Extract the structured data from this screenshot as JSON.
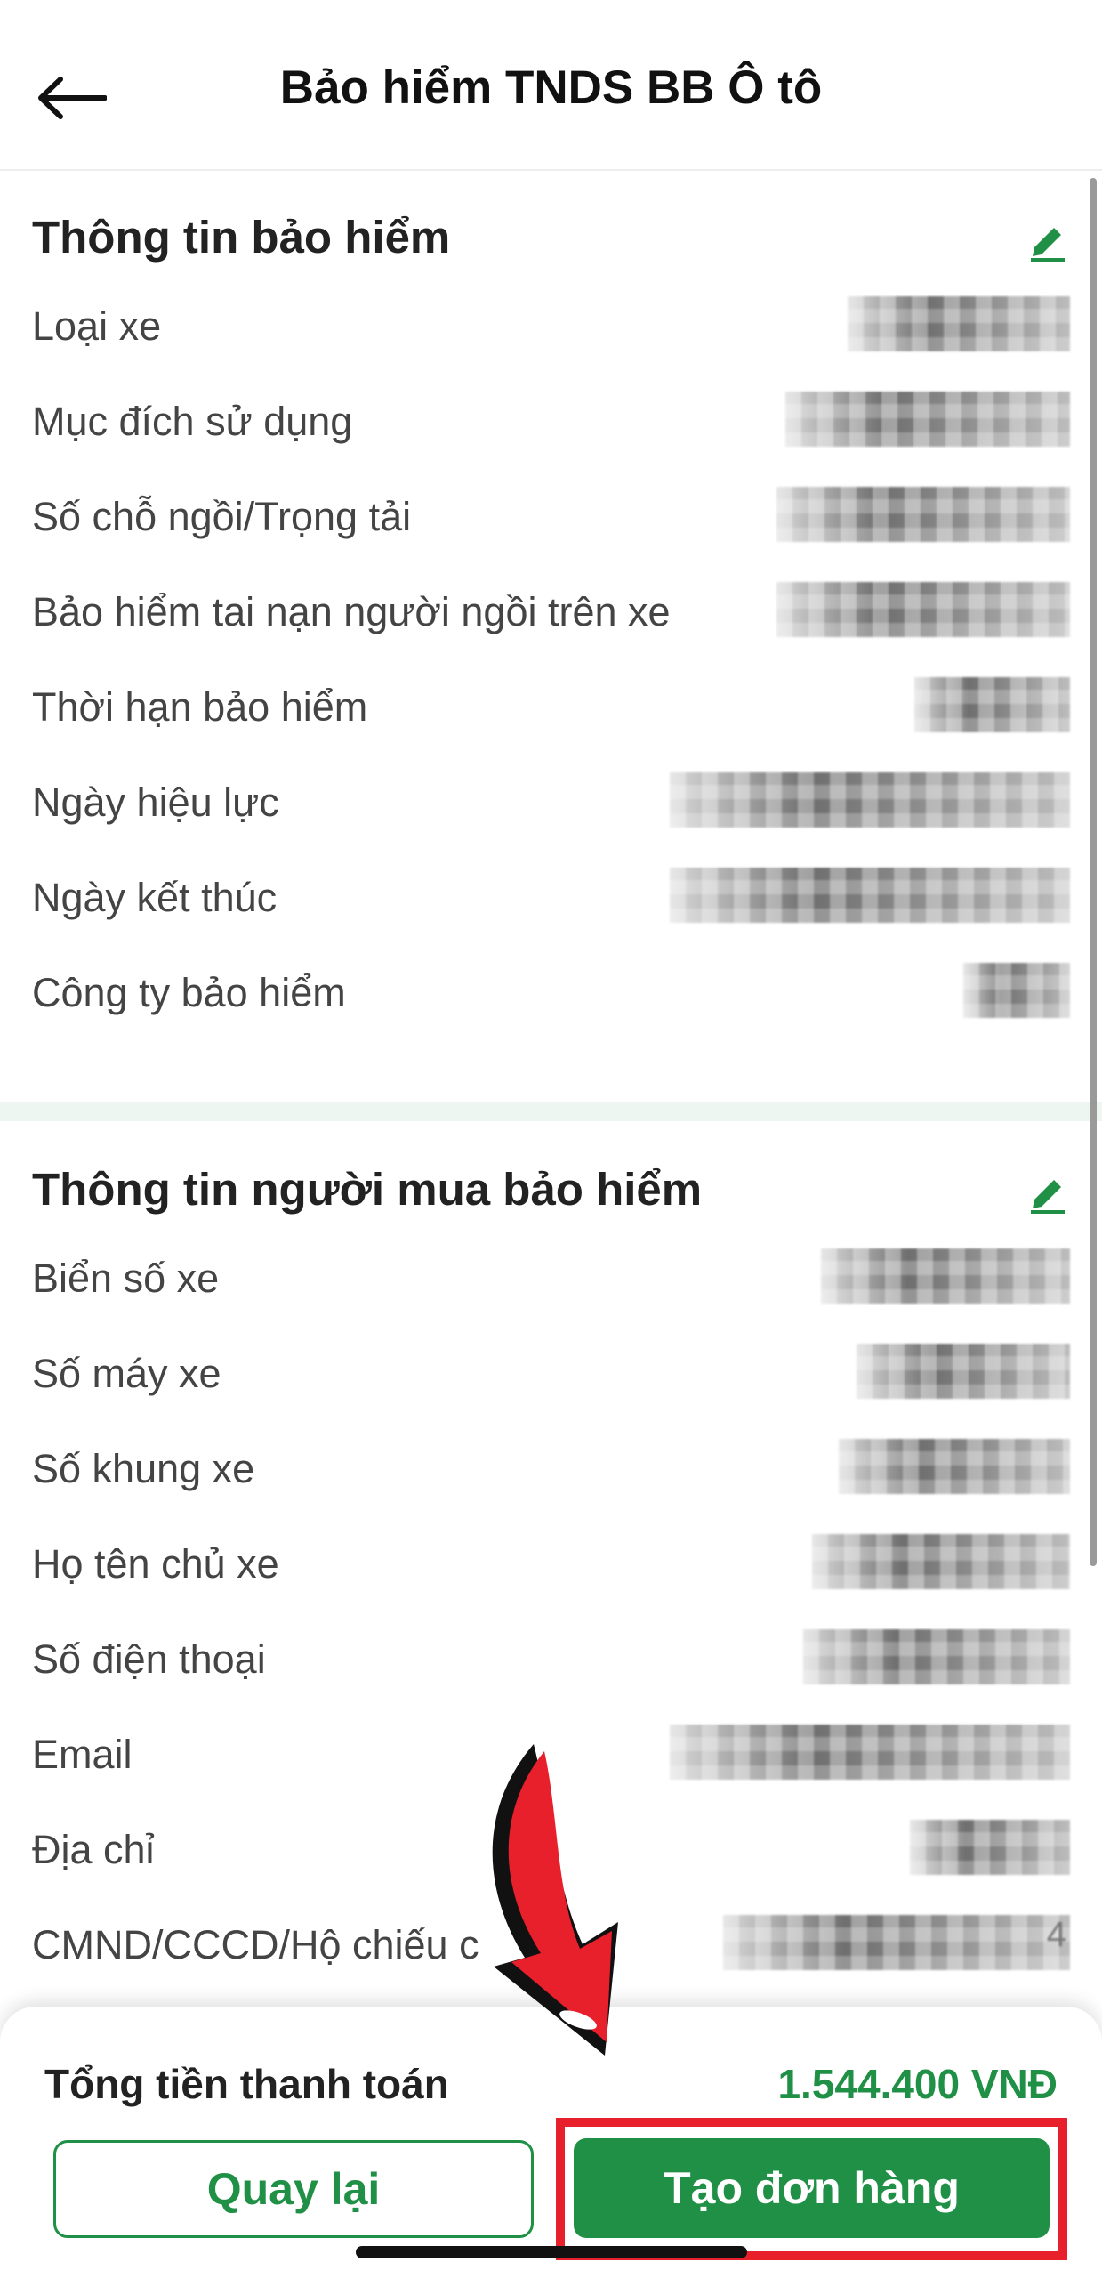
{
  "header": {
    "title": "Bảo hiểm TNDS BB Ô tô"
  },
  "insurance_info": {
    "title": "Thông tin bảo hiểm",
    "rows": [
      {
        "label": "Loại xe"
      },
      {
        "label": "Mục đích sử dụng"
      },
      {
        "label": "Số chỗ ngồi/Trọng tải"
      },
      {
        "label": "Bảo hiểm tai nạn người ngồi trên xe"
      },
      {
        "label": "Thời hạn bảo hiểm"
      },
      {
        "label": "Ngày hiệu lực"
      },
      {
        "label": "Ngày kết thúc"
      },
      {
        "label": "Công ty bảo hiểm"
      }
    ]
  },
  "buyer_info": {
    "title": "Thông tin người mua bảo hiểm",
    "rows": [
      {
        "label": "Biển số xe"
      },
      {
        "label": "Số máy xe"
      },
      {
        "label": "Số khung xe"
      },
      {
        "label": "Họ tên chủ xe"
      },
      {
        "label": "Số điện thoại"
      },
      {
        "label": "Email"
      },
      {
        "label": "Địa chỉ"
      },
      {
        "label": "CMND/CCCD/Hộ chiếu c",
        "value": "4"
      }
    ]
  },
  "footer": {
    "total_label": "Tổng tiền thanh toán",
    "total_value": "1.544.400 VNĐ",
    "back_label": "Quay lại",
    "create_label": "Tạo đơn hàng"
  },
  "colors": {
    "accent": "#1f9046",
    "highlight": "#e8202b"
  },
  "icons": {
    "back": "arrow-left-icon",
    "edit": "pencil-icon",
    "callout": "curved-arrow-icon"
  }
}
